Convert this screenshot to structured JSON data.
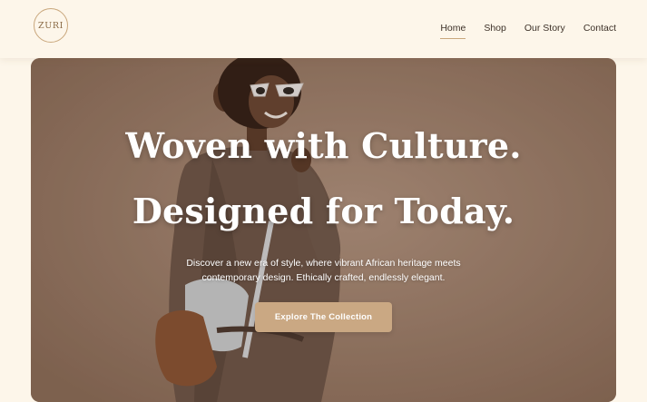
{
  "brand": {
    "logo_text": "ZURI"
  },
  "nav": {
    "items": [
      {
        "label": "Home",
        "active": true
      },
      {
        "label": "Shop",
        "active": false
      },
      {
        "label": "Our Story",
        "active": false
      },
      {
        "label": "Contact",
        "active": false
      }
    ]
  },
  "hero": {
    "headline_line1": "Woven with Culture.",
    "headline_line2": "Designed for Today.",
    "subtext_line1": "Discover a new era of style, where vibrant African heritage meets",
    "subtext_line2": "contemporary design. Ethically crafted, endlessly elegant.",
    "cta_label": "Explore The Collection"
  },
  "colors": {
    "page_background": "#fdf6ea",
    "accent": "#caa883",
    "hero_background": "#9c7d68",
    "nav_text": "#3d3128"
  }
}
